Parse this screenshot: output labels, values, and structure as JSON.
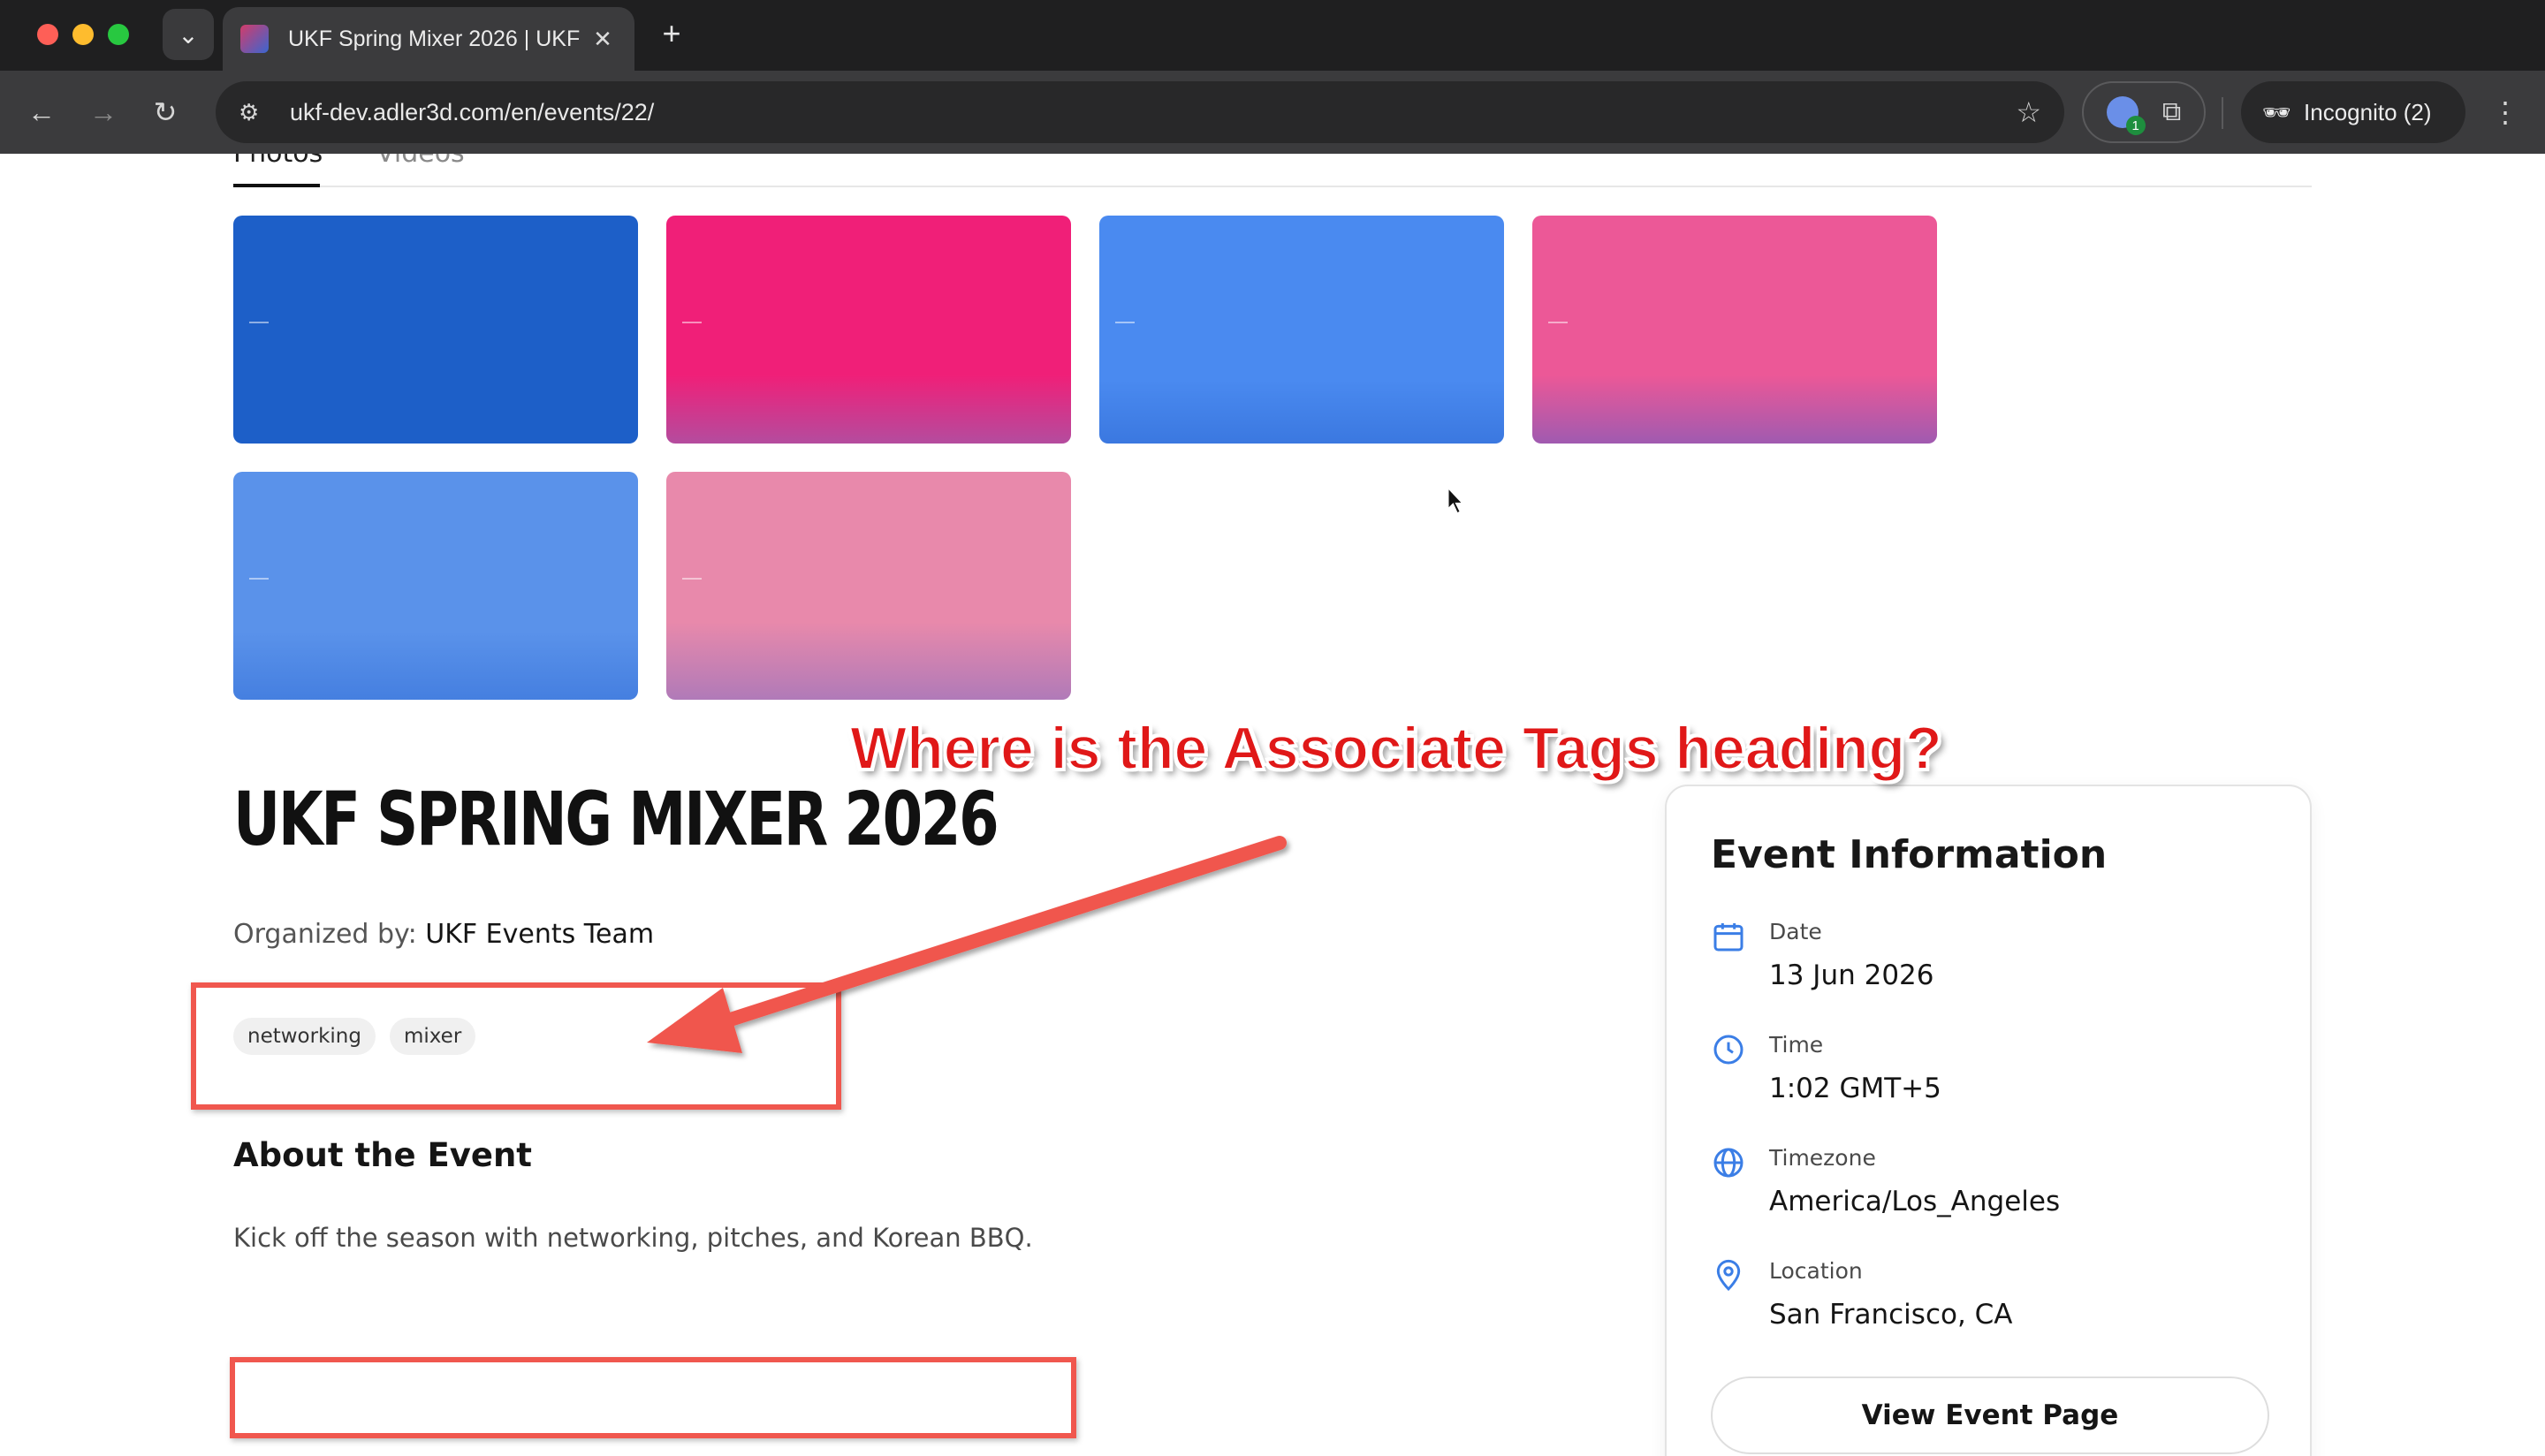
{
  "browser": {
    "tab_title": "UKF Spring Mixer 2026 | UKF",
    "tab_close": "✕",
    "new_tab": "+",
    "url": "ukf-dev.adler3d.com/en/events/22/",
    "extension_badge": "1",
    "incognito_label": "Incognito (2)"
  },
  "media": {
    "tabs": [
      {
        "label": "Photos",
        "active": true
      },
      {
        "label": "Videos",
        "active": false
      }
    ],
    "photo_colors": [
      "#1d5fc8",
      "#f01f78",
      "#4a8af0",
      "#ec5897",
      "#5a92ea",
      "#e889ab"
    ]
  },
  "event": {
    "title": "UKF SPRING MIXER 2026",
    "organized_by_label": "Organized by:",
    "organizer": "UKF Events Team",
    "tags": [
      "networking",
      "mixer"
    ],
    "about_heading": "About the Event",
    "about_text": "Kick off the season with networking, pitches, and Korean BBQ."
  },
  "info_card": {
    "title": "Event Information",
    "rows": [
      {
        "label": "Date",
        "value": "13 Jun 2026",
        "icon": "calendar-icon"
      },
      {
        "label": "Time",
        "value": "1:02 GMT+5",
        "icon": "clock-icon"
      },
      {
        "label": "Timezone",
        "value": "America/Los_Angeles",
        "icon": "globe-icon"
      },
      {
        "label": "Location",
        "value": "San Francisco, CA",
        "icon": "location-pin-icon"
      }
    ],
    "button_label": "View Event Page"
  },
  "annotation": {
    "text": "Where is the Associate Tags heading?",
    "color": "#e01818",
    "box_color": "#f0574e"
  }
}
